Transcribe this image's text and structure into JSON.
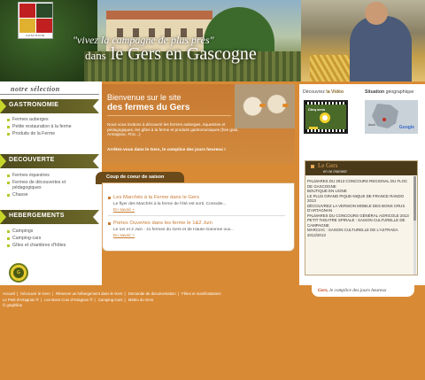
{
  "header": {
    "logo_caption": "GASCOGNE",
    "slogan_line1": "\"vivez la campagne de plus près\"",
    "slogan_line2_prefix": "dans",
    "slogan_line2_name": "le Gers en Gascogne"
  },
  "sidebar": {
    "selection_title": "notre sélection",
    "categories": [
      {
        "label": "GASTRONOMIE",
        "items": [
          "Fermes auberges",
          "Petite restauration à la ferme",
          "Produits de la Ferme"
        ]
      },
      {
        "label": "DECOUVERTE",
        "items": [
          "Fermes équestres",
          "Fermes de découvertes et pédagogiques",
          "Chasse"
        ]
      },
      {
        "label": "HEBERGEMENTS",
        "items": [
          "Campings",
          "Camping-cars",
          "Gîtes et chambres d'hôtes"
        ]
      }
    ]
  },
  "welcome": {
    "title_line1": "Bienvenue sur le site",
    "title_line2": "des fermes du Gers",
    "description": "Nous vous invitons à découvrir les fermes auberges, équestres et pédagogiques, les gîtes à la ferme et produits gastronomiques (foie gras, Armagnac, Floc...)",
    "cta": "Arrêtez-vous dans le Gers, le complice des jours heureux !"
  },
  "coeur": {
    "tab_label": "Coup de coeur de saison",
    "news": [
      {
        "title": "Les Marchés à la Ferme dans le Gers",
        "text": "Le flyer des Marchés à la ferme de l'été est sorti. Consulte...",
        "more": "En savoir +"
      },
      {
        "title": "Portes Ouvertes dans les ferme le 1&2 Juin",
        "text": "Le 1er et 2 Juin : 41 fermes du Gers et de Haute-Garonne ouv...",
        "more": "En savoir +"
      }
    ]
  },
  "right": {
    "video_title_prefix": "Découvrez",
    "video_title_strong": "la Vidéo",
    "video_thumb_label": "Cinq sens",
    "geo_title_strong": "Situation",
    "geo_title_rest": "géographique",
    "geo_pin": "Auch",
    "geo_brand": "Google",
    "gers_title": "Le Gers",
    "gers_subtitle": "en ce moment",
    "gers_items": [
      "PALMARES DU 2013 CONCOURS REGIONAL DU FLOC DE GASCOGNE",
      "BOUTIQUE EN LIGNE",
      "LE PLUS GRAND PIQUE-NIQUE DE FRANCE RANDO 2013",
      "DÉCOUVREZ LA VERSION MOBILE DES BONS CRUS D'ARTAGNAN",
      "PALMARES DU CONCOURS GÉNÉRAL AGRICOLE 2013",
      "PETIT THEATRE SPIRALE : SAISON CULTURELLE DE CAMPAGNE",
      "MARCIAC : SAISON CULTURELLE DE L'ASTRADA 2012/2013"
    ]
  },
  "slogan_bar": {
    "brand": "Gers,",
    "text": "le complice des jours heureux"
  },
  "footer": {
    "line1": [
      "Accueil",
      "Découvrir le Gers",
      "Réserver un hébergement dans le Gers",
      "Demande de documentation",
      "Fêtes et manifestations"
    ],
    "line2": [
      "Le Petit d'Artagnan ®",
      "Les Bons Crus d'Artagnan ®",
      "Camping-Cars",
      "Météo du Gers"
    ],
    "copyright": "© graphifun"
  },
  "colors": {
    "page_bg": "#d98a35",
    "category_accent": "#c8d62a",
    "category_bg": "#4e4a1e",
    "link_orange": "#c77a32"
  }
}
